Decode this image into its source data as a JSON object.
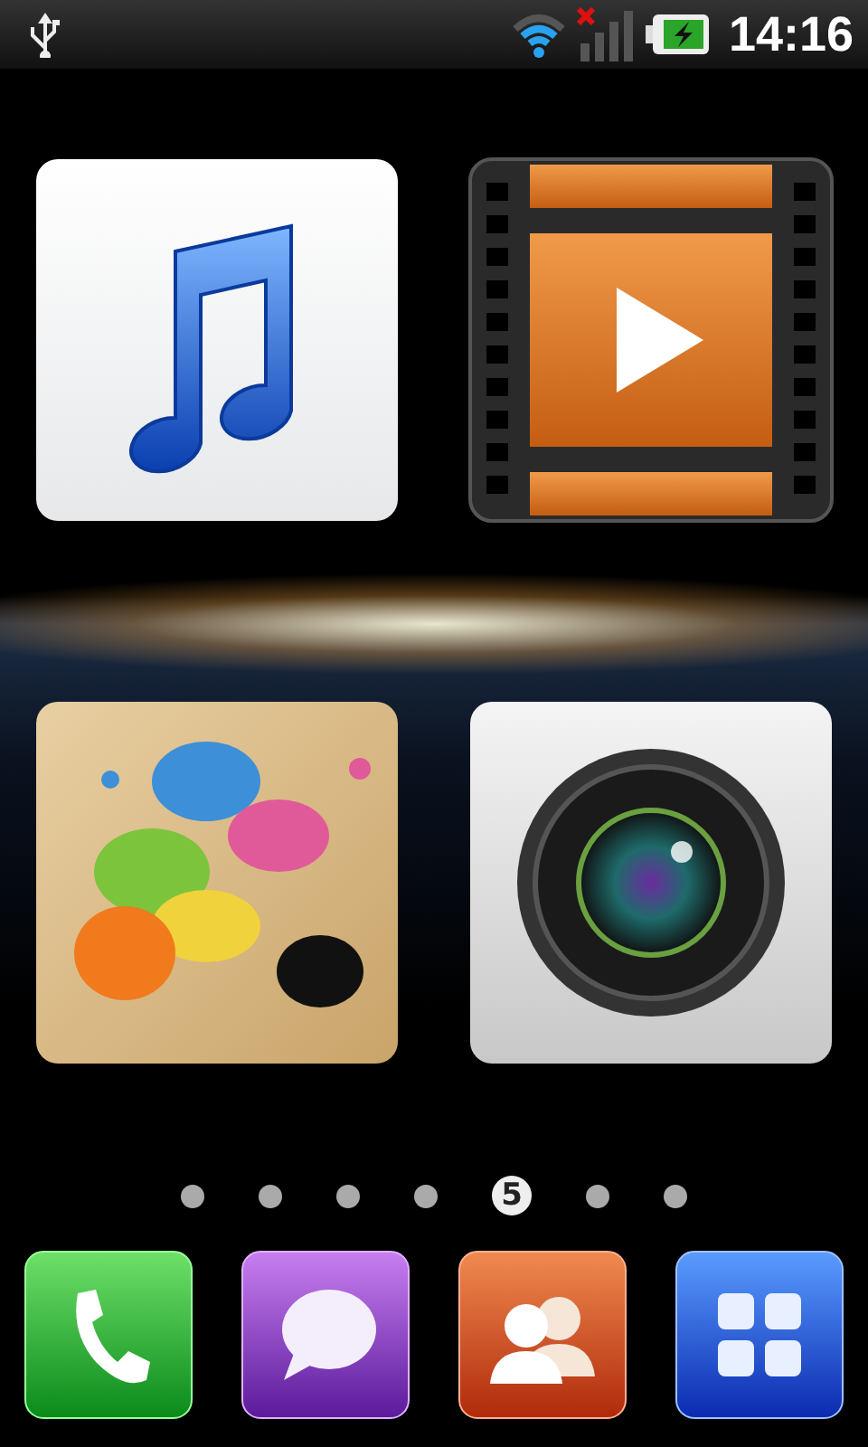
{
  "status_bar": {
    "time": "14:16"
  },
  "apps": [
    {
      "kind": "music"
    },
    {
      "kind": "video"
    },
    {
      "kind": "paint"
    },
    {
      "kind": "camera"
    }
  ],
  "pages": [
    {
      "selected": false
    },
    {
      "selected": false
    },
    {
      "selected": false
    },
    {
      "selected": false
    },
    {
      "selected": true,
      "label": "5"
    },
    {
      "selected": false
    },
    {
      "selected": false
    }
  ],
  "dock": [
    {
      "kind": "phone"
    },
    {
      "kind": "messages"
    },
    {
      "kind": "contacts"
    },
    {
      "kind": "apps"
    }
  ]
}
